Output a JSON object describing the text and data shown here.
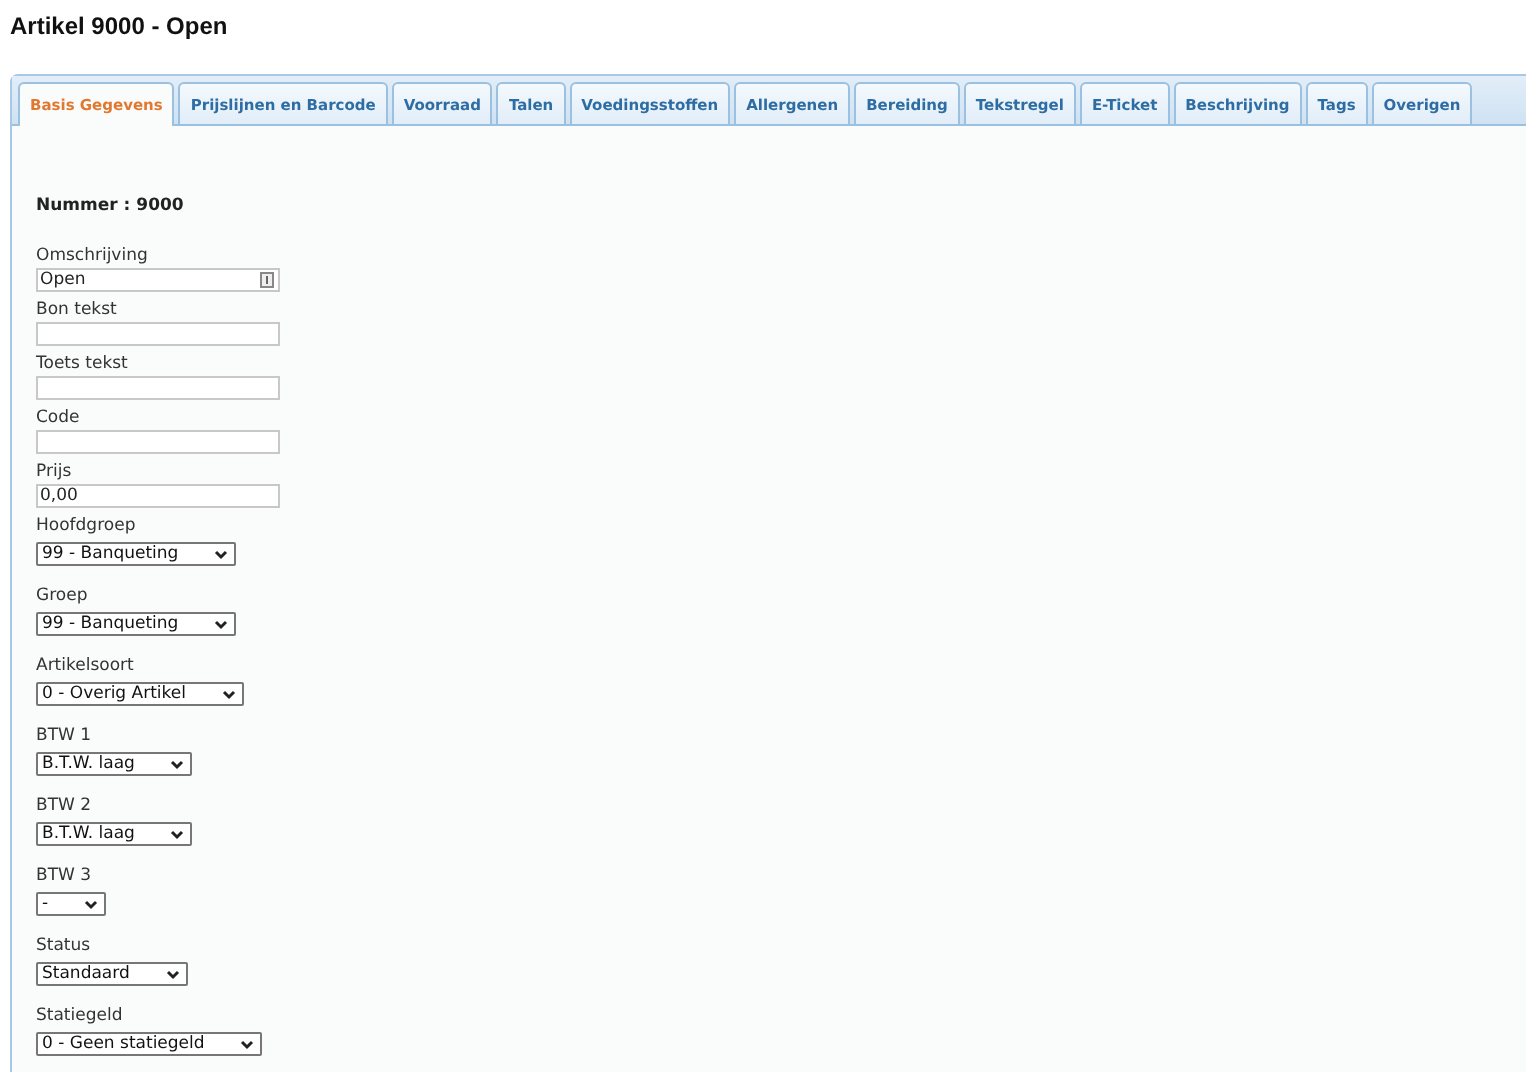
{
  "title": "Artikel 9000 - Open",
  "tabs": [
    {
      "label": "Basis Gegevens",
      "selected": true
    },
    {
      "label": "Prijslijnen en Barcode",
      "selected": false
    },
    {
      "label": "Voorraad",
      "selected": false
    },
    {
      "label": "Talen",
      "selected": false
    },
    {
      "label": "Voedingsstoffen",
      "selected": false
    },
    {
      "label": "Allergenen",
      "selected": false
    },
    {
      "label": "Bereiding",
      "selected": false
    },
    {
      "label": "Tekstregel",
      "selected": false
    },
    {
      "label": "E-Ticket",
      "selected": false
    },
    {
      "label": "Beschrijving",
      "selected": false
    },
    {
      "label": "Tags",
      "selected": false
    },
    {
      "label": "Overigen",
      "selected": false
    }
  ],
  "number_label": "Nummer : 9000",
  "fields": [
    {
      "kind": "text",
      "label": "Omschrijving",
      "value": "Open",
      "has_icon": true
    },
    {
      "kind": "text",
      "label": "Bon tekst"
    },
    {
      "kind": "text",
      "label": "Toets tekst"
    },
    {
      "kind": "text",
      "label": "Code"
    },
    {
      "kind": "text",
      "label": "Prijs",
      "value": "0,00"
    },
    {
      "kind": "select",
      "label": "Hoofdgroep",
      "value": "99 - Banqueting"
    },
    {
      "kind": "select",
      "label": "Groep",
      "value": "99 - Banqueting"
    },
    {
      "kind": "select",
      "label": "Artikelsoort",
      "value": "0 - Overig Artikel"
    },
    {
      "kind": "select",
      "label": "BTW 1",
      "value": "B.T.W. laag"
    },
    {
      "kind": "select",
      "label": "BTW 2",
      "value": "B.T.W. laag"
    },
    {
      "kind": "select",
      "label": "BTW 3",
      "value": "-"
    },
    {
      "kind": "select",
      "label": "Status",
      "value": "Standaard"
    },
    {
      "kind": "select",
      "label": "Statiegeld",
      "value": "0 - Geen statiegeld"
    }
  ]
}
